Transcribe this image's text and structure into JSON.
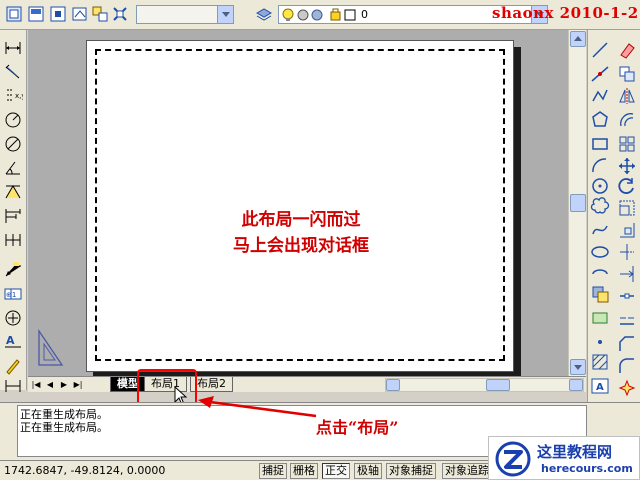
{
  "watermark": "shaonx 2010-1-2",
  "layer_toolbar": {
    "current_layer": "0"
  },
  "drawing": {
    "message_line1": "此布局一闪而过",
    "message_line2": "马上会出现对话框"
  },
  "tabs": [
    {
      "label": "模型",
      "active": true
    },
    {
      "label": "布局1",
      "active": false
    },
    {
      "label": "布局2",
      "active": false
    }
  ],
  "command_history": [
    "正在重生成布局。",
    "正在重生成布局。"
  ],
  "annotation": {
    "callout": "点击“布局”"
  },
  "status_bar": {
    "coordinates": "1742.6847, -49.8124, 0.0000",
    "buttons": [
      {
        "label": "捕捉",
        "on": false
      },
      {
        "label": "栅格",
        "on": false
      },
      {
        "label": "正交",
        "on": true
      },
      {
        "label": "极轴",
        "on": false
      },
      {
        "label": "对象捕捉",
        "on": false
      },
      {
        "label": "对象追踪",
        "on": false
      }
    ]
  },
  "logo": {
    "name": "这里教程网",
    "site": "herecours.com"
  },
  "colors": {
    "accent_red": "#d00000",
    "logo_blue": "#1a3fae",
    "canvas_gray": "#adadad"
  }
}
